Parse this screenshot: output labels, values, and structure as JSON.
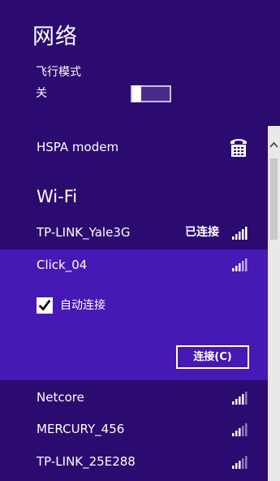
{
  "header": {
    "title": "网络"
  },
  "airplane_mode": {
    "label": "飞行模式",
    "state_label": "关",
    "enabled": false
  },
  "connections": {
    "mobile": {
      "name": "HSPA modem",
      "icon": "telephone-icon"
    },
    "wifi_section_title": "Wi-Fi",
    "networks": [
      {
        "name": "TP-LINK_Yale3G",
        "status": "已连接",
        "signal_icon": "signal-bars-icon"
      },
      {
        "name": "Click_04",
        "status": "",
        "signal_icon": "signal-bars-icon",
        "auto_connect_label": "自动连接",
        "auto_connect": true,
        "connect_label": "连接(C)"
      },
      {
        "name": "Netcore",
        "status": "",
        "signal_icon": "signal-bars-icon"
      },
      {
        "name": "MERCURY_456",
        "status": "",
        "signal_icon": "signal-bars-icon"
      },
      {
        "name": "TP-LINK_25E288",
        "status": "",
        "signal_icon": "signal-bars-icon"
      }
    ]
  },
  "colors": {
    "panel_background": "#2b0b6f",
    "selected_background": "#4618b4",
    "scrollbar_track": "#e9e9ea",
    "scrollbar_thumb": "#c9c9cc",
    "text": "#ffffff"
  }
}
